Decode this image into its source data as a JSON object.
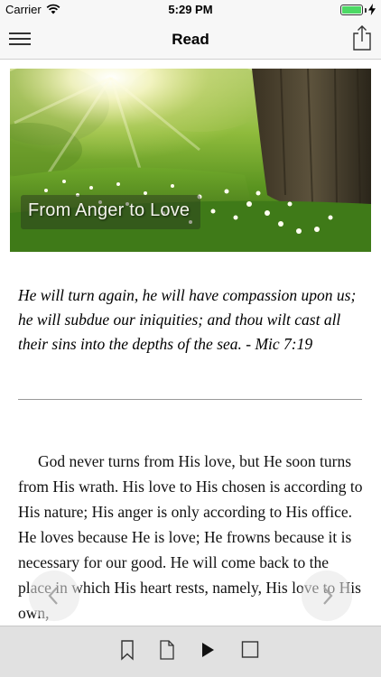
{
  "status_bar": {
    "carrier": "Carrier",
    "time": "5:29 PM",
    "battery_color": "#4cd964"
  },
  "nav": {
    "title": "Read",
    "left_icon": "menu-icon",
    "right_icon": "share-icon"
  },
  "hero": {
    "caption": "From Anger to Love"
  },
  "verse": {
    "text": "He will turn again, he will have compassion upon us; he will subdue our iniquities; and thou wilt cast all their sins into the depths of the sea. - Mic 7:19"
  },
  "body": {
    "text": "God never turns from His love, but He soon turns from His wrath. His love to His chosen is according to His nature; His anger is only according to His office. He loves because He is love; He frowns because it is necessary for our good. He will come back to the place in which His heart rests, namely, His love to His own,"
  },
  "pager": {
    "prev_icon": "chevron-left-icon",
    "next_icon": "chevron-right-icon"
  },
  "toolbar": {
    "items": [
      "bookmark-icon",
      "document-icon",
      "play-icon",
      "stop-icon"
    ]
  }
}
